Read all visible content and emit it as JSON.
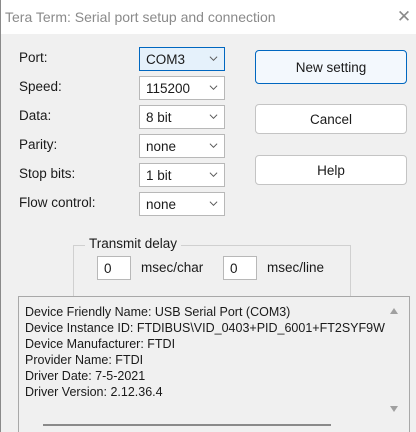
{
  "window": {
    "title": "Tera Term: Serial port setup and connection",
    "close_glyph": "✕"
  },
  "fields": {
    "port": {
      "label": "Port:",
      "value": "COM3"
    },
    "speed": {
      "label": "Speed:",
      "value": "115200"
    },
    "data": {
      "label": "Data:",
      "value": "8 bit"
    },
    "parity": {
      "label": "Parity:",
      "value": "none"
    },
    "stop_bits": {
      "label": "Stop bits:",
      "value": "1 bit"
    },
    "flow_control": {
      "label": "Flow control:",
      "value": "none"
    }
  },
  "buttons": {
    "new_setting": "New setting",
    "cancel": "Cancel",
    "help": "Help"
  },
  "transmit_delay": {
    "title": "Transmit delay",
    "char_value": "0",
    "char_unit": "msec/char",
    "line_value": "0",
    "line_unit": "msec/line"
  },
  "device_info": {
    "lines": [
      "Device Friendly Name: USB Serial Port (COM3)",
      "Device Instance ID: FTDIBUS\\VID_0403+PID_6001+FT2SYF9W",
      "Device Manufacturer: FTDI",
      "Provider Name: FTDI",
      "Driver Date: 7-5-2021",
      "Driver Version: 2.12.36.4"
    ]
  },
  "colors": {
    "accent": "#0067c0",
    "dialog_bg": "#f0f0f0",
    "title_text": "#8a8a8a"
  },
  "icons": {
    "close": "close-icon",
    "dropdown": "chevron-down-icon",
    "scroll_up": "scroll-up-arrow-icon",
    "scroll_down": "scroll-down-arrow-icon"
  }
}
